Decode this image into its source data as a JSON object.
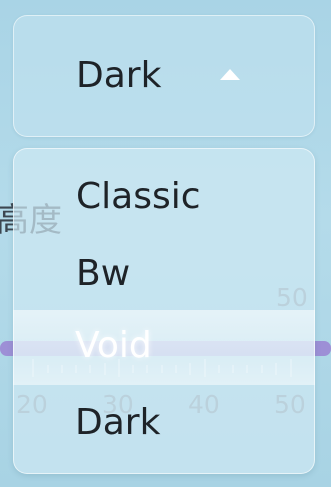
{
  "background_slider": {
    "label": "高度",
    "max_value": "50",
    "tick_labels": [
      "20",
      "30",
      "40",
      "50"
    ],
    "track_color": "#9d8fd6"
  },
  "theme_select": {
    "selected_value": "Dark",
    "caret_icon": "caret-up-icon",
    "options": [
      "Classic",
      "Bw",
      "Void",
      "Dark"
    ],
    "highlighted_option": "Void"
  }
}
